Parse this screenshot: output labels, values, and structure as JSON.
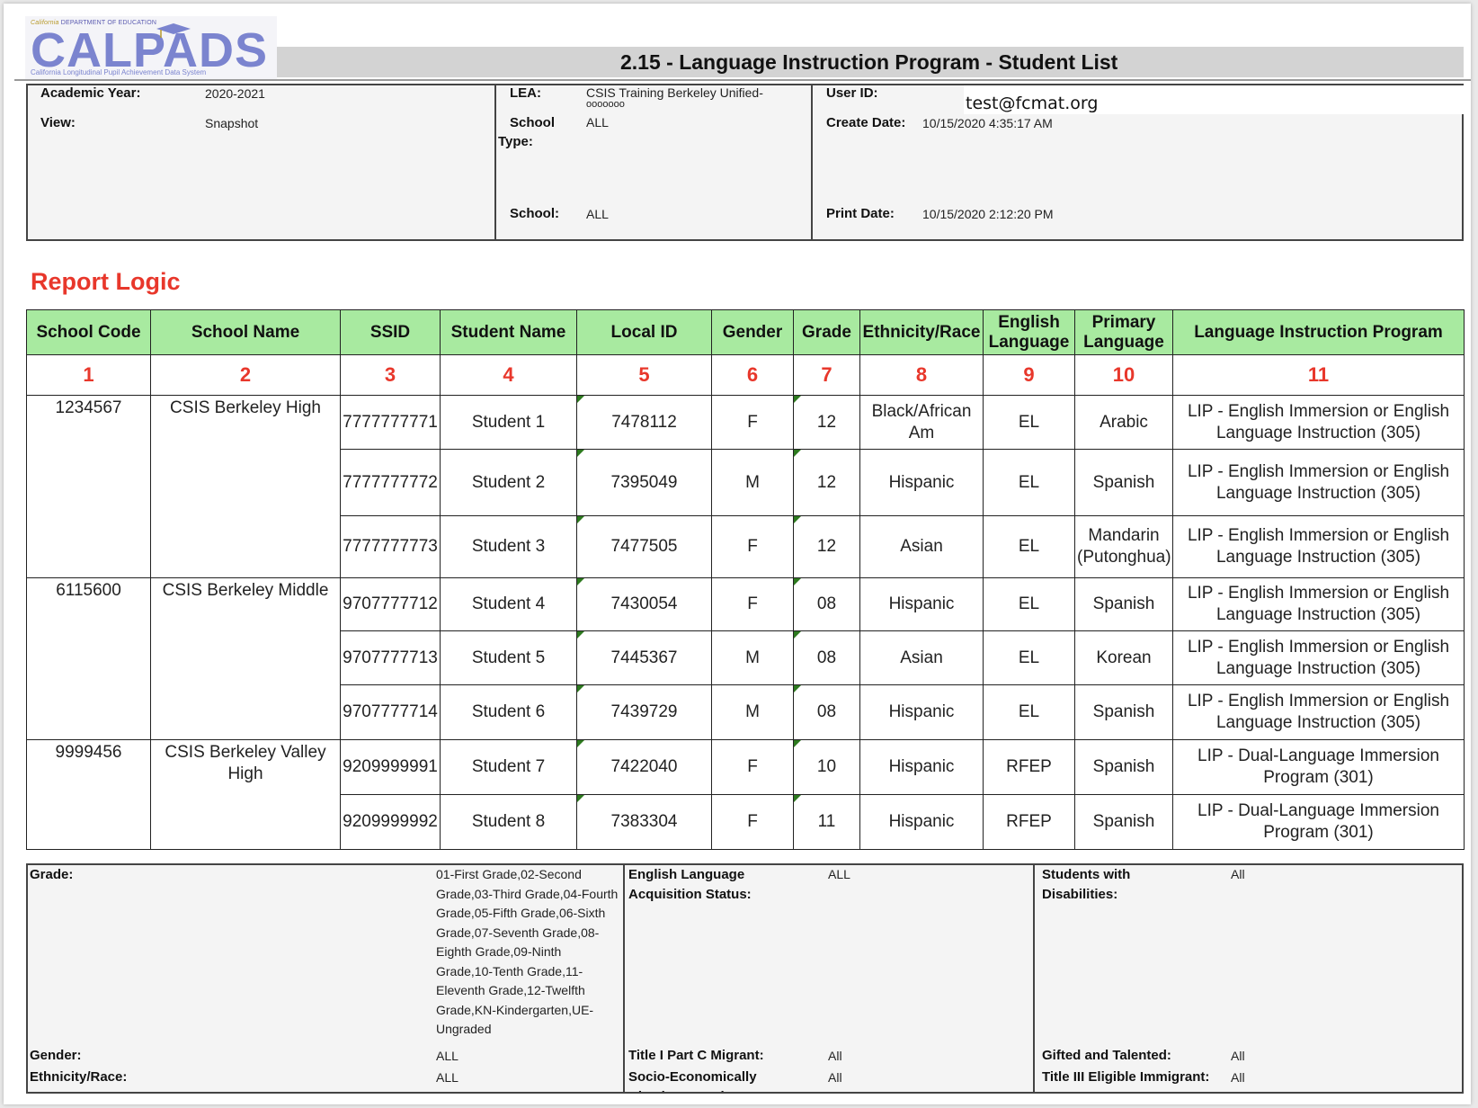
{
  "header": {
    "logo": {
      "department": "California DEPARTMENT OF EDUCATION",
      "department_state": "California",
      "department_rest": "DEPARTMENT OF EDUCATION",
      "wordmark": "CALPADS",
      "subtitle": "California Longitudinal Pupil Achievement Data System"
    },
    "title": "2.15 - Language Instruction Program - Student List"
  },
  "info": {
    "academic_year_label": "Academic Year:",
    "academic_year": "2020-2021",
    "view_label": "View:",
    "view": "Snapshot",
    "lea_label": "LEA:",
    "lea": "CSIS Training Berkeley Unified-",
    "lea_code": "ooooooo",
    "school_type_label_1": "School",
    "school_type_label_2": "Type:",
    "school_type": "ALL",
    "school_label": "School:",
    "school": "ALL",
    "user_id_label": "User ID:",
    "user_id": "test@fcmat.org",
    "create_date_label": "Create Date:",
    "create_date": "10/15/2020 4:35:17 AM",
    "print_date_label": "Print Date:",
    "print_date": "10/15/2020 2:12:20 PM"
  },
  "report_logic": {
    "heading": "Report Logic",
    "accent_color": "#e8372b",
    "header_color": "#a8eaa0"
  },
  "table": {
    "columns": [
      {
        "label": "School Code",
        "num": "1"
      },
      {
        "label": "School Name",
        "num": "2"
      },
      {
        "label": "SSID",
        "num": "3"
      },
      {
        "label": "Student Name",
        "num": "4"
      },
      {
        "label": "Local ID",
        "num": "5"
      },
      {
        "label": "Gender",
        "num": "6"
      },
      {
        "label": "Grade",
        "num": "7"
      },
      {
        "label": "Ethnicity/Race",
        "num": "8"
      },
      {
        "label": "English Language",
        "num": "9"
      },
      {
        "label": "Primary Language",
        "num": "10"
      },
      {
        "label": "Language Instruction Program",
        "num": "11"
      }
    ],
    "groups": [
      {
        "school_code": "1234567",
        "school_name": "CSIS Berkeley High",
        "rows": [
          {
            "ssid": "7777777771",
            "student_name": "Student 1",
            "local_id": "7478112",
            "gender": "F",
            "grade": "12",
            "ethnicity": "Black/African Am",
            "english_language": "EL",
            "primary_language": "Arabic",
            "program": "LIP - English Immersion or English Language Instruction (305)"
          },
          {
            "ssid": "7777777772",
            "student_name": "Student 2",
            "local_id": "7395049",
            "gender": "M",
            "grade": "12",
            "ethnicity": "Hispanic",
            "english_language": "EL",
            "primary_language": "Spanish",
            "program": "LIP - English Immersion or English Language Instruction (305)"
          },
          {
            "ssid": "7777777773",
            "student_name": "Student 3",
            "local_id": "7477505",
            "gender": "F",
            "grade": "12",
            "ethnicity": "Asian",
            "english_language": "EL",
            "primary_language": "Mandarin (Putonghua)",
            "program": "LIP - English Immersion or English Language Instruction (305)"
          }
        ]
      },
      {
        "school_code": "6115600",
        "school_name": "CSIS Berkeley Middle",
        "rows": [
          {
            "ssid": "9707777712",
            "student_name": "Student 4",
            "local_id": "7430054",
            "gender": "F",
            "grade": "08",
            "ethnicity": "Hispanic",
            "english_language": "EL",
            "primary_language": "Spanish",
            "program": "LIP - English Immersion or English Language Instruction (305)"
          },
          {
            "ssid": "9707777713",
            "student_name": "Student 5",
            "local_id": "7445367",
            "gender": "M",
            "grade": "08",
            "ethnicity": "Asian",
            "english_language": "EL",
            "primary_language": "Korean",
            "program": "LIP - English Immersion or English Language Instruction (305)"
          },
          {
            "ssid": "9707777714",
            "student_name": "Student 6",
            "local_id": "7439729",
            "gender": "M",
            "grade": "08",
            "ethnicity": "Hispanic",
            "english_language": "EL",
            "primary_language": "Spanish",
            "program": "LIP - English Immersion or English Language Instruction (305)"
          }
        ]
      },
      {
        "school_code": "9999456",
        "school_name": "CSIS Berkeley Valley High",
        "rows": [
          {
            "ssid": "9209999991",
            "student_name": "Student 7",
            "local_id": "7422040",
            "gender": "F",
            "grade": "10",
            "ethnicity": "Hispanic",
            "english_language": "RFEP",
            "primary_language": "Spanish",
            "program": "LIP - Dual-Language Immersion Program (301)"
          },
          {
            "ssid": "9209999992",
            "student_name": "Student 8",
            "local_id": "7383304",
            "gender": "F",
            "grade": "11",
            "ethnicity": "Hispanic",
            "english_language": "RFEP",
            "primary_language": "Spanish",
            "program": "LIP - Dual-Language Immersion Program (301)"
          }
        ]
      }
    ]
  },
  "filters": {
    "grade_label": "Grade:",
    "grade": "01-First Grade,02-Second Grade,03-Third Grade,04-Fourth Grade,05-Fifth Grade,06-Sixth Grade,07-Seventh Grade,08-Eighth Grade,09-Ninth Grade,10-Tenth Grade,11-Eleventh Grade,12-Twelfth Grade,KN-Kindergarten,UE-Ungraded",
    "gender_label": "Gender:",
    "gender": "ALL",
    "ethnicity_label": "Ethnicity/Race:",
    "ethnicity": "ALL",
    "elas_label": "English Language Acquisition Status:",
    "elas": "ALL",
    "migrant_label": "Title I Part C Migrant:",
    "migrant": "All",
    "sed_label": "Socio-Economically Disadvantaged:",
    "sed": "All",
    "swd_label": "Students with Disabilities:",
    "swd": "All",
    "gate_label": "Gifted and Talented:",
    "gate": "All",
    "immigrant_label": "Title III Eligible Immigrant:",
    "immigrant": "All"
  }
}
